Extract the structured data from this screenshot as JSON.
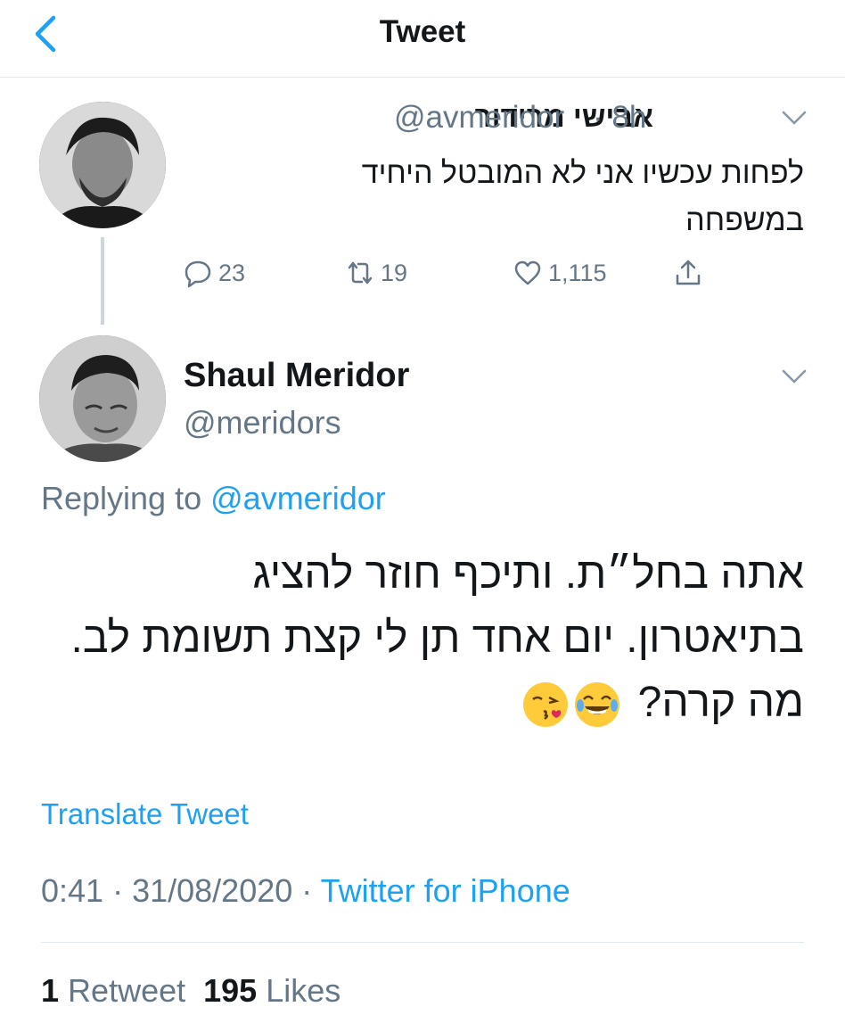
{
  "header": {
    "title": "Tweet"
  },
  "parent_tweet": {
    "name": "אבישי מרידור",
    "handle": "@avmeridor",
    "time": "· 8h",
    "text_line1": "לפחות עכשיו אני לא המובטל היחיד",
    "text_line2": "במשפחה",
    "replies": "23",
    "retweets": "19",
    "likes": "1,115"
  },
  "tweet": {
    "name": "Shaul Meridor",
    "handle": "@meridors",
    "replying_prefix": "Replying to",
    "replying_to": "@avmeridor",
    "line1": "אתה בחל״ת. ותיכף חוזר להציג",
    "line2": "בתיאטרון. יום אחד תן לי קצת תשומת לב.",
    "line3": "מה קרה?",
    "emojis": [
      "face-with-tears-of-joy",
      "face-blowing-a-kiss"
    ],
    "translate_label": "Translate Tweet",
    "time": "0:41",
    "date": "31/08/2020",
    "source": "Twitter for iPhone",
    "retweet_count": "1",
    "retweet_label": "Retweet",
    "like_count": "195",
    "like_label": "Likes"
  },
  "colors": {
    "accent": "#1da1f2",
    "secondary_text": "#657786",
    "divider": "#e1e8ed"
  }
}
